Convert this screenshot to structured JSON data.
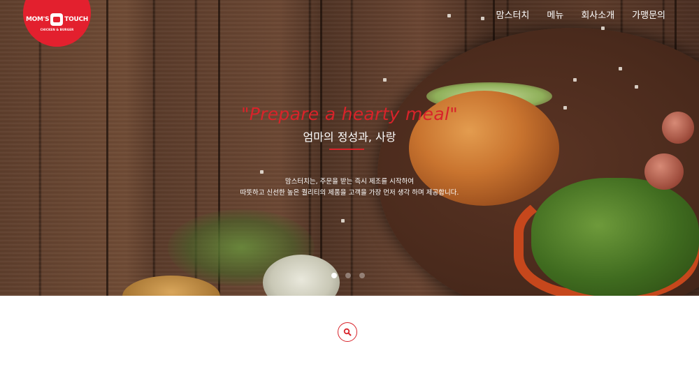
{
  "brand": {
    "name_left": "MOM'S",
    "name_right": "TOUCH",
    "subline": "CHICKEN & BURGER",
    "color": "#e3202e"
  },
  "nav": {
    "items": [
      {
        "label": "맘스터치"
      },
      {
        "label": "메뉴"
      },
      {
        "label": "회사소개"
      },
      {
        "label": "가맹문의"
      }
    ]
  },
  "hero": {
    "tagline": "\"Prepare a hearty meal\"",
    "subtitle": "엄마의 정성과, 사랑",
    "description": [
      "맘스터치는, 주문을 받는 즉시 제조를 시작하여",
      "따뜻하고 신선한 높은 퀄리티의 제품을 고객을 가장 먼저 생각 하며 제공합니다."
    ],
    "accent_color": "#d8232a",
    "slides_total": 3,
    "active_slide": 1
  },
  "search": {
    "icon": "search-icon"
  }
}
